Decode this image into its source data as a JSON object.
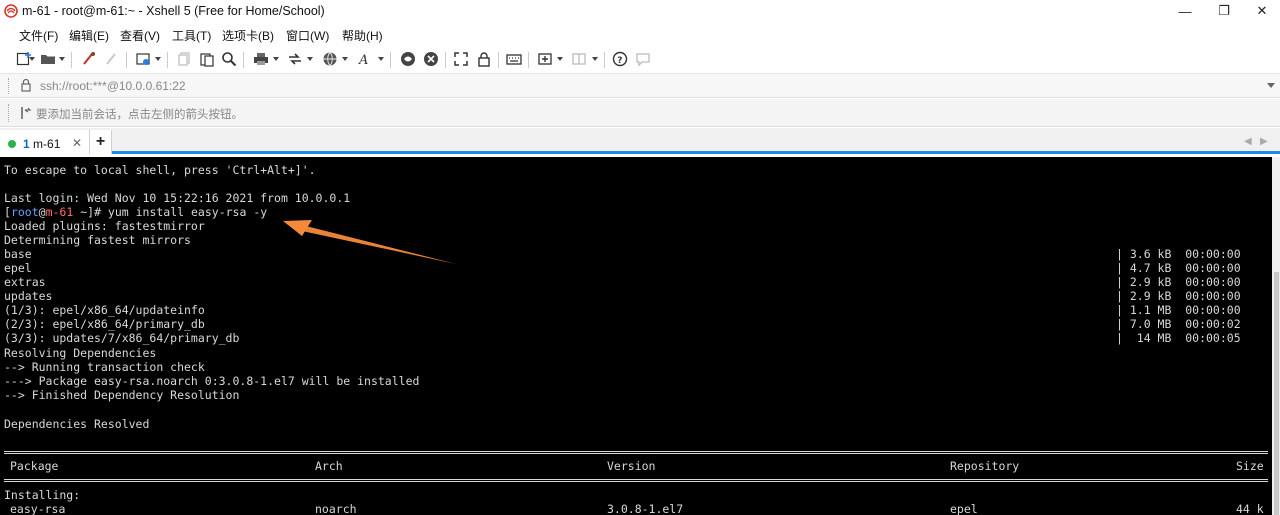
{
  "window": {
    "title": "m-61 - root@m-61:~ - Xshell 5 (Free for Home/School)",
    "minimize_glyph": "—",
    "maximize_glyph": "❐",
    "close_glyph": "✕"
  },
  "menu": [
    "文件(F)",
    "编辑(E)",
    "查看(V)",
    "工具(T)",
    "选项卡(B)",
    "窗口(W)",
    "帮助(H)"
  ],
  "address": {
    "value": "ssh://root:***@10.0.0.61:22"
  },
  "hint": {
    "text": "要添加当前会话，点击左侧的箭头按钮。"
  },
  "tabs": [
    {
      "number": "1",
      "name": "m-61",
      "close": "✕"
    }
  ],
  "tab_add": "+",
  "tab_nav": {
    "prev": "◀",
    "next": "▶"
  },
  "colors": {
    "accent": "#1e88e5",
    "session_dot": "#2db14a",
    "arrow": "#f58a3a",
    "prompt_user": "#6aa0ff",
    "prompt_host": "#ff6a6a"
  },
  "terminal": {
    "escape_line": "To escape to local shell, press 'Ctrl+Alt+]'.",
    "last_login": "Last login: Wed Nov 10 15:22:16 2021 from 10.0.0.1",
    "prompt": {
      "open": "[",
      "user": "root",
      "at": "@",
      "host": "m-61",
      "cwd": " ~",
      "close": "]#",
      "command": " yum install easy-rsa -y"
    },
    "loaded_plugins": "Loaded plugins: fastestmirror",
    "determining": "Determining fastest mirrors",
    "downloads": [
      {
        "name": "base",
        "size": "| 3.6 kB  00:00:00"
      },
      {
        "name": "epel",
        "size": "| 4.7 kB  00:00:00"
      },
      {
        "name": "extras",
        "size": "| 2.9 kB  00:00:00"
      },
      {
        "name": "updates",
        "size": "| 2.9 kB  00:00:00"
      },
      {
        "name": "(1/3): epel/x86_64/updateinfo",
        "size": "| 1.1 MB  00:00:00"
      },
      {
        "name": "(2/3): epel/x86_64/primary_db",
        "size": "| 7.0 MB  00:00:02"
      },
      {
        "name": "(3/3): updates/7/x86_64/primary_db",
        "size": "|  14 MB  00:00:05"
      }
    ],
    "resolving": "Resolving Dependencies",
    "running_check": "--> Running transaction check",
    "package_line": "---> Package easy-rsa.noarch 0:3.0.8-1.el7 will be installed",
    "finished": "--> Finished Dependency Resolution",
    "deps_resolved": "Dependencies Resolved",
    "table": {
      "headers": [
        "Package",
        "Arch",
        "Version",
        "Repository",
        "Size"
      ],
      "installing": "Installing:",
      "row": [
        "easy-rsa",
        "noarch",
        "3.0.8-1.el7",
        "epel",
        "44 k"
      ]
    }
  }
}
